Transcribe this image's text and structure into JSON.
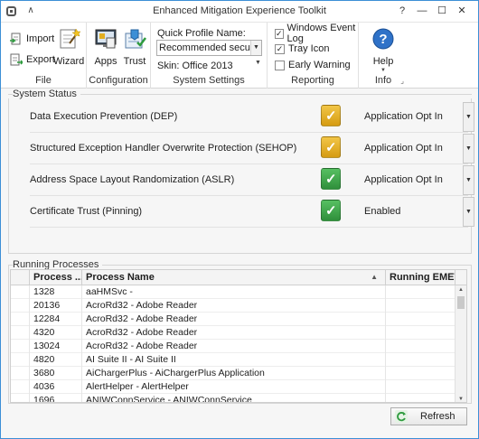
{
  "window": {
    "title": "Enhanced Mitigation Experience Toolkit"
  },
  "titlebar": {
    "collapse_glyph": "∧",
    "help_glyph": "?",
    "minimize_glyph": "—",
    "maximize_glyph": "☐",
    "close_glyph": "✕"
  },
  "ribbon": {
    "file": {
      "label": "File",
      "import": "Import",
      "export": "Export",
      "wizard": "Wizard"
    },
    "configuration": {
      "label": "Configuration",
      "apps": "Apps",
      "trust": "Trust"
    },
    "system_settings": {
      "label": "System Settings",
      "quick_profile_label": "Quick Profile Name:",
      "quick_profile_value": "Recommended security ...",
      "skin_label": "Skin: Office 2013"
    },
    "reporting": {
      "label": "Reporting",
      "options": [
        {
          "label": "Windows Event Log",
          "checked": true
        },
        {
          "label": "Tray Icon",
          "checked": true
        },
        {
          "label": "Early Warning",
          "checked": false
        }
      ]
    },
    "info": {
      "label": "Info",
      "help": "Help"
    }
  },
  "system_status": {
    "title": "System Status",
    "rows": [
      {
        "label": "Data Execution Prevention (DEP)",
        "value": "Application Opt In",
        "status_color": "#e2ae21",
        "icon": "yellow-check-shield"
      },
      {
        "label": "Structured Exception Handler Overwrite Protection (SEHOP)",
        "value": "Application Opt In",
        "status_color": "#e2ae21",
        "icon": "yellow-check-shield"
      },
      {
        "label": "Address Space Layout Randomization (ASLR)",
        "value": "Application Opt In",
        "status_color": "#3aa64a",
        "icon": "green-check-shield"
      },
      {
        "label": "Certificate Trust (Pinning)",
        "value": "Enabled",
        "status_color": "#3aa64a",
        "icon": "green-check-shield"
      }
    ]
  },
  "running_processes": {
    "title": "Running Processes",
    "columns": [
      "Process ...",
      "Process Name",
      "Running EMET"
    ],
    "rows": [
      {
        "id": "1328",
        "name": "aaHMSvc -",
        "emet": ""
      },
      {
        "id": "20136",
        "name": "AcroRd32 - Adobe Reader",
        "emet": ""
      },
      {
        "id": "12284",
        "name": "AcroRd32 - Adobe Reader",
        "emet": ""
      },
      {
        "id": "4320",
        "name": "AcroRd32 - Adobe Reader",
        "emet": ""
      },
      {
        "id": "13024",
        "name": "AcroRd32 - Adobe Reader",
        "emet": ""
      },
      {
        "id": "4820",
        "name": "AI Suite II - AI Suite II",
        "emet": ""
      },
      {
        "id": "3680",
        "name": "AiChargerPlus - AiChargerPlus Application",
        "emet": ""
      },
      {
        "id": "4036",
        "name": "AlertHelper - AlertHelper",
        "emet": ""
      },
      {
        "id": "1696",
        "name": "ANIWConnService - ANIWConnService",
        "emet": ""
      }
    ]
  },
  "refresh_label": "Refresh",
  "colors": {
    "accent": "#3c8fd6",
    "warn": "#e2ae21",
    "ok": "#3aa64a"
  }
}
